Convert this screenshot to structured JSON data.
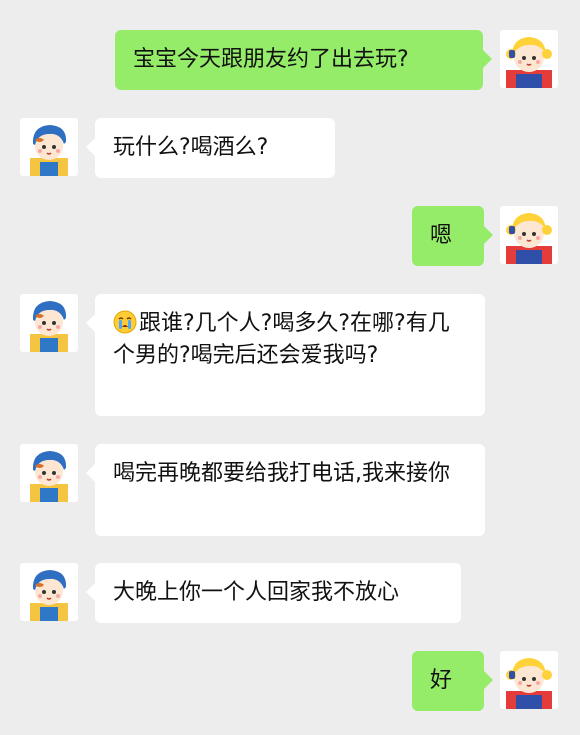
{
  "chat": {
    "messages": [
      {
        "side": "right",
        "text": "宝宝今天跟朋友约了出去玩?"
      },
      {
        "side": "left",
        "text": "玩什么?喝酒么?"
      },
      {
        "side": "right",
        "text": "嗯"
      },
      {
        "side": "left",
        "emoji": "crying-face",
        "text": "跟谁?几个人?喝多久?在哪?有几个男的?喝完后还会爱我吗?"
      },
      {
        "side": "left",
        "text": "喝完再晚都要给我打电话,我来接你"
      },
      {
        "side": "left",
        "text": "大晚上你一个人回家我不放心"
      },
      {
        "side": "right",
        "text": "好"
      }
    ]
  },
  "colors": {
    "background": "#ededed",
    "bubble_self": "#95ec69",
    "bubble_other": "#ffffff"
  }
}
